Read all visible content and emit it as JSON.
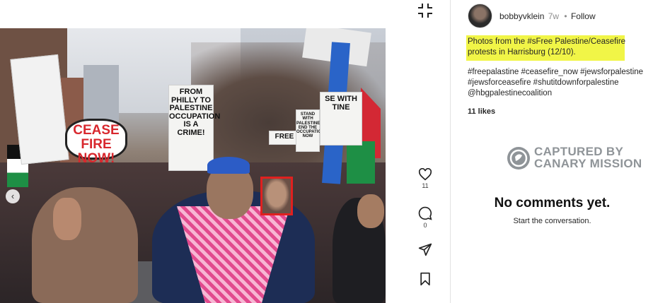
{
  "post": {
    "username": "bobbyvklein",
    "age": "7w",
    "separator": "•",
    "follow_label": "Follow",
    "caption_line1": "Photos from the #sFree Palestine/Ceasefire",
    "caption_line2": "protests in Harrisburg (12/10).",
    "hashtags": "#freepalastine #ceasefire_now #jewsforpalestine #jewsforceasefire #shutitdownforpalestine @hbgpalestinecoalition",
    "likes": "11 likes",
    "like_count": "11",
    "comment_count": "0",
    "no_comments_title": "No comments yet.",
    "no_comments_sub": "Start the conversation."
  },
  "photo": {
    "sign_cease": "CEASE FIRE NOW!",
    "sign_philly": "FROM PHILLY TO PALESTINE OCCUPATION IS A CRIME!",
    "sign_free": "FREE",
    "sign_stand": "STAND WITH PALESTINE END THE OCCUPATION NOW",
    "sign_sewith": "SE WITH TINE",
    "carousel_prev": "‹"
  },
  "watermark": {
    "line1": "CAPTURED BY",
    "line2": "CANARY MISSION"
  },
  "icons": {
    "collapse": "collapse-icon",
    "like": "heart-icon",
    "comment": "comment-icon",
    "share": "share-icon",
    "save": "bookmark-icon"
  },
  "colors": {
    "highlight": "#f1f547",
    "face_box": "#e0201f",
    "secondary_text": "#8e8e8e"
  }
}
